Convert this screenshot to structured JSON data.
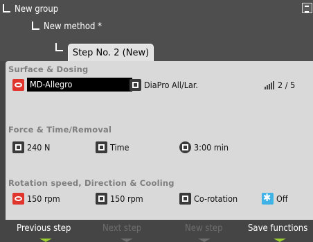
{
  "breadcrumbs": {
    "group": "New group",
    "method": "New method *",
    "step": "Step No. 2 (New)"
  },
  "sections": {
    "surface_dosing": {
      "title": "Surface & Dosing",
      "surface_value": "MD-Allegro",
      "suspension_value": "DiaPro All/Lar.",
      "dosing_level": "2 / 5"
    },
    "force_time": {
      "title": "Force & Time/Removal",
      "force_value": "240 N",
      "mode_value": "Time",
      "time_value": "3:00 min"
    },
    "rotation": {
      "title": "Rotation speed, Direction & Cooling",
      "disc_speed": "150 rpm",
      "holder_speed": "150 rpm",
      "direction": "Co-rotation",
      "cooling": "Off"
    }
  },
  "footer": {
    "previous_step": "Previous step",
    "next_step": "Next step",
    "new_step": "New step",
    "save_functions": "Save functions"
  },
  "colors": {
    "accent_green": "#9acd32",
    "surface_red": "#e0352d",
    "cooling_blue": "#3fb3e6"
  }
}
